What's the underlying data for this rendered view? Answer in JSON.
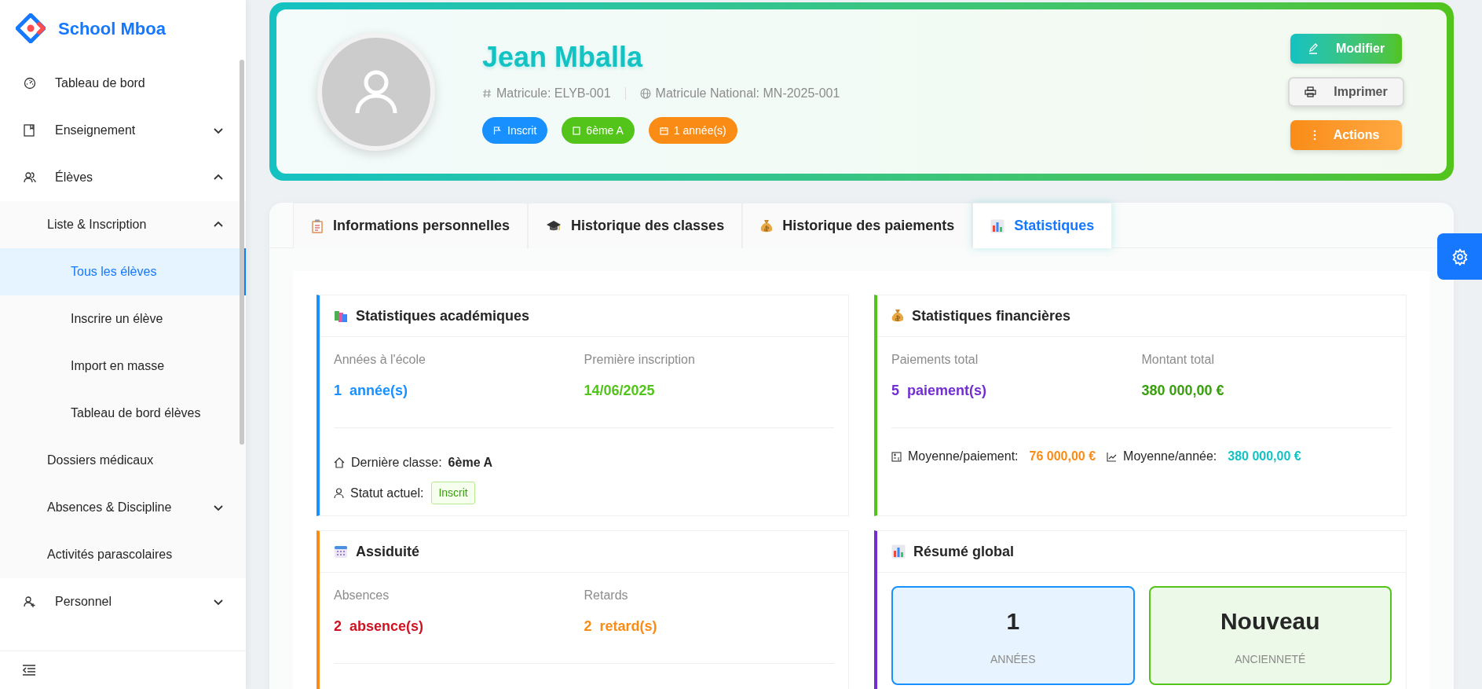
{
  "sidebar": {
    "logo": "School Mboa",
    "items": [
      {
        "label": "Tableau de bord",
        "selected": false
      },
      {
        "label": "Enseignement",
        "selected": false,
        "expanded": false
      },
      {
        "label": "Élèves",
        "selected": false,
        "expanded": true,
        "children": [
          {
            "label": "Liste & Inscription",
            "selected": false,
            "expanded": true,
            "children": [
              {
                "label": "Tous les élèves",
                "selected": true
              },
              {
                "label": "Inscrire un élève",
                "selected": false
              },
              {
                "label": "Import en masse",
                "selected": false
              },
              {
                "label": "Tableau de bord élèves",
                "selected": false
              }
            ]
          },
          {
            "label": "Dossiers médicaux",
            "selected": false
          },
          {
            "label": "Absences & Discipline",
            "selected": false,
            "expanded": false
          },
          {
            "label": "Activités parascolaires",
            "selected": false
          }
        ]
      },
      {
        "label": "Personnel",
        "selected": false,
        "expanded": false
      }
    ]
  },
  "profile": {
    "name": "Jean Mballa",
    "matricule": "Matricule: ELYB-001",
    "national": "Matricule National: MN-2025-001",
    "badges": [
      {
        "label": "Inscrit",
        "color": "#1890ff"
      },
      {
        "label": "6ème A",
        "color": "#52c41a"
      },
      {
        "label": "1 année(s)",
        "color": "#fa8c16"
      }
    ],
    "actions": [
      {
        "label": "Modifier",
        "kind": "primary"
      },
      {
        "label": "Imprimer",
        "kind": "default"
      },
      {
        "label": "Actions",
        "kind": "warning"
      }
    ]
  },
  "tabs": [
    {
      "label": "Informations personnelles",
      "selected": false
    },
    {
      "label": "Historique des classes",
      "selected": false
    },
    {
      "label": "Historique des paiements",
      "selected": false
    },
    {
      "label": "Statistiques",
      "selected": true
    }
  ],
  "cards": [
    {
      "title": "Statistiques académiques",
      "color": "#1890ff",
      "fields": [
        {
          "label": "Années à l'école",
          "count": "1",
          "unit": "année(s)",
          "color": "#1890ff"
        },
        {
          "label": "Première inscription",
          "count": "14/06/2025",
          "color": "#52c41a"
        }
      ],
      "details": [
        {
          "kind": "bold",
          "label": "Dernière classe:",
          "value": "6ème A"
        },
        {
          "kind": "tag",
          "label": "Statut actuel:",
          "value": "Inscrit"
        }
      ]
    },
    {
      "title": "Statistiques financières",
      "color": "#52c41a",
      "fields": [
        {
          "label": "Paiements total",
          "count": "5",
          "unit": "paiement(s)",
          "color": "#722ed1"
        },
        {
          "label": "Montant total",
          "count": "380 000,00 €",
          "color": "#389e0d"
        }
      ],
      "inline": [
        {
          "label": "Moyenne/paiement:",
          "value": "76 000,00 €",
          "color": "#fa8c16"
        },
        {
          "label": "Moyenne/année:",
          "value": "380 000,00 €",
          "color": "#13c2c2"
        }
      ]
    },
    {
      "title": "Assiduité",
      "color": "#fa8c16",
      "fields": [
        {
          "label": "Absences",
          "count": "2",
          "unit": "absence(s)",
          "color": "#cf1322"
        },
        {
          "label": "Retards",
          "count": "2",
          "unit": "retard(s)",
          "color": "#fa8c16"
        }
      ]
    },
    {
      "title": "Résumé global",
      "color": "#722ed1",
      "summary": [
        {
          "value": "1",
          "label": "ANNÉES",
          "color": "#1890ff"
        },
        {
          "value": "Nouveau",
          "label": "ANCIENNETÉ",
          "color": "#52c41a"
        }
      ]
    }
  ]
}
